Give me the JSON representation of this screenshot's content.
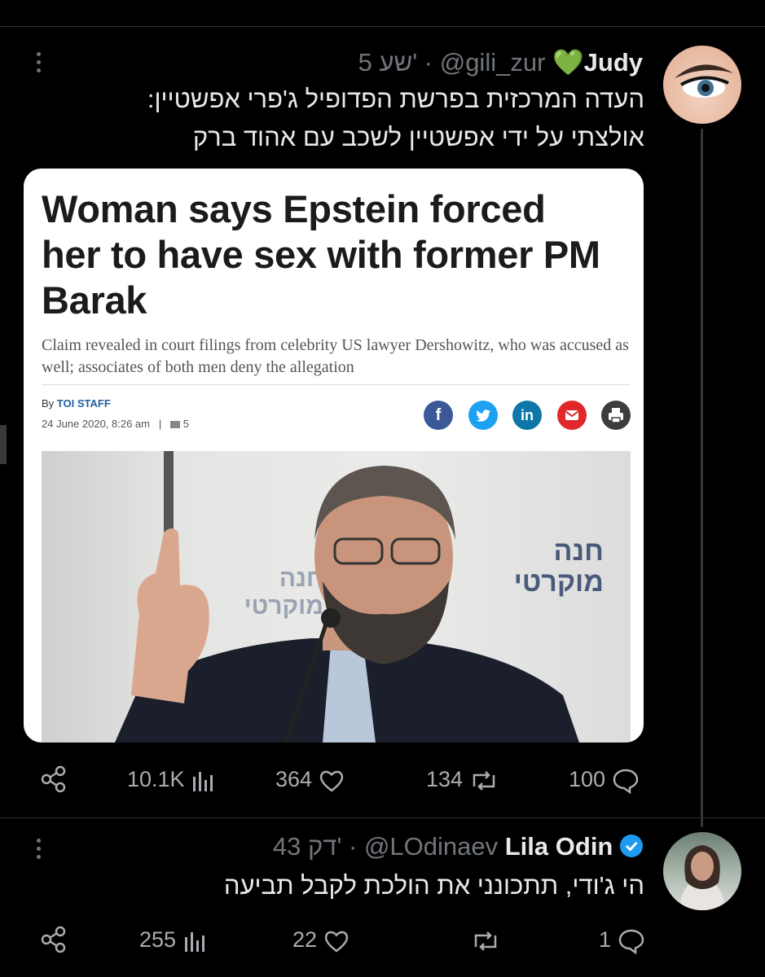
{
  "tweet1": {
    "display_name": "Judy",
    "emoji": "💚",
    "handle": "@gili_zur",
    "separator": "·",
    "time": "5 שע'",
    "text_line1": "העדה המרכזית בפרשת הפדופיל ג'פרי אפשטיין:",
    "text_line2": "אולצתי על ידי אפשטיין לשכב עם אהוד ברק",
    "card": {
      "headline": "Woman says Epstein forced her to have sex with former PM Barak",
      "subhead": "Claim revealed in court filings from celebrity US lawyer Dershowitz, who was accused as well; associates of both men deny the allegation",
      "by_label": "By",
      "author": "TOI STAFF",
      "date": "24 June 2020, 8:26 am",
      "divider": "|",
      "comments": "5",
      "share_icons": [
        "facebook-icon",
        "twitter-icon",
        "linkedin-icon",
        "email-icon",
        "print-icon"
      ],
      "share_colors": [
        "#3b5998",
        "#1da1f2",
        "#0e76a8",
        "#e0282b",
        "#3d3d3d"
      ],
      "photo_banner_text_1": "חנה",
      "photo_banner_text_2": "מוקרטי"
    },
    "views": "10.1K",
    "likes": "364",
    "retweets": "134",
    "replies": "100"
  },
  "tweet2": {
    "display_name": "Lila Odin",
    "handle": "@LOdinaev",
    "separator": "·",
    "time": "43 דק'",
    "text": "הי ג'ודי, תתכונני את הולכת לקבל תביעה",
    "views": "255",
    "likes": "22",
    "retweets": "",
    "replies": "1"
  },
  "colors": {
    "background": "#000000",
    "text": "#e7e9ea",
    "muted": "#71767b",
    "verified": "#1d9bf0",
    "emoji_heart": "#5cb85c"
  }
}
